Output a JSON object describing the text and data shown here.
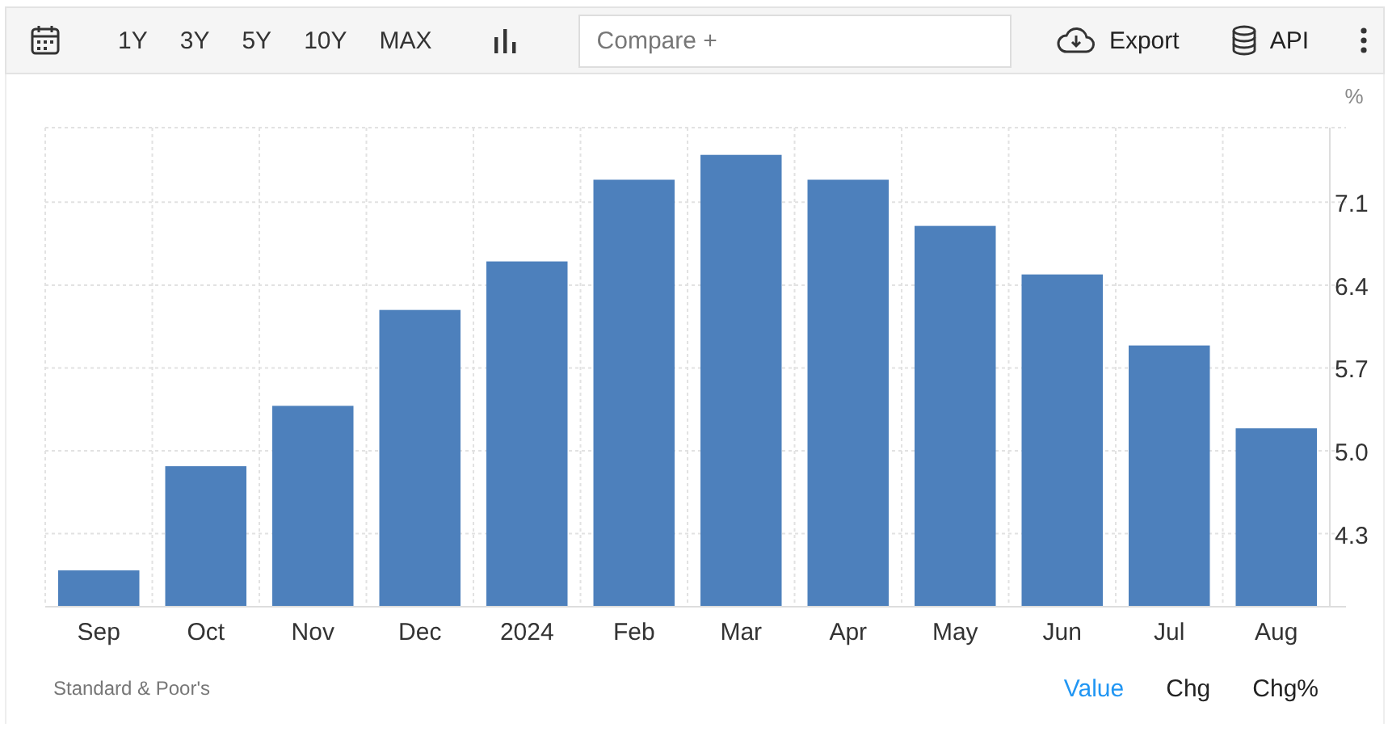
{
  "toolbar": {
    "ranges": [
      {
        "label": "1Y",
        "selected": false
      },
      {
        "label": "3Y",
        "selected": false
      },
      {
        "label": "5Y",
        "selected": false
      },
      {
        "label": "10Y",
        "selected": false
      },
      {
        "label": "MAX",
        "selected": false
      }
    ],
    "compare": {
      "placeholder": "Compare +"
    },
    "export": "Export",
    "api": "API"
  },
  "chart": {
    "unit": "%",
    "chart_data": {
      "type": "bar",
      "categories": [
        "Sep",
        "Oct",
        "Nov",
        "Dec",
        "2024",
        "Feb",
        "Mar",
        "Apr",
        "May",
        "Jun",
        "Jul",
        "Aug"
      ],
      "series": [
        {
          "color": "#4d80bc",
          "values": [
            3.99,
            4.87,
            5.38,
            6.19,
            6.6,
            7.29,
            7.5,
            7.29,
            6.9,
            6.49,
            5.89,
            5.19
          ]
        }
      ],
      "ylim": [
        3.69,
        7.73
      ],
      "yticks": [
        {
          "value": 4.3,
          "label": "4.3"
        },
        {
          "value": 5,
          "label": "5.0"
        },
        {
          "value": 5.7,
          "label": "5.7"
        },
        {
          "value": 6.4,
          "label": "6.4"
        },
        {
          "value": 7.1,
          "label": "7.1"
        }
      ],
      "grid": true
    }
  },
  "footer": {
    "source": "Standard & Poor's",
    "modes": [
      {
        "label": "Value",
        "selected": true
      },
      {
        "label": "Chg",
        "selected": false
      },
      {
        "label": "Chg%",
        "selected": false
      }
    ]
  }
}
